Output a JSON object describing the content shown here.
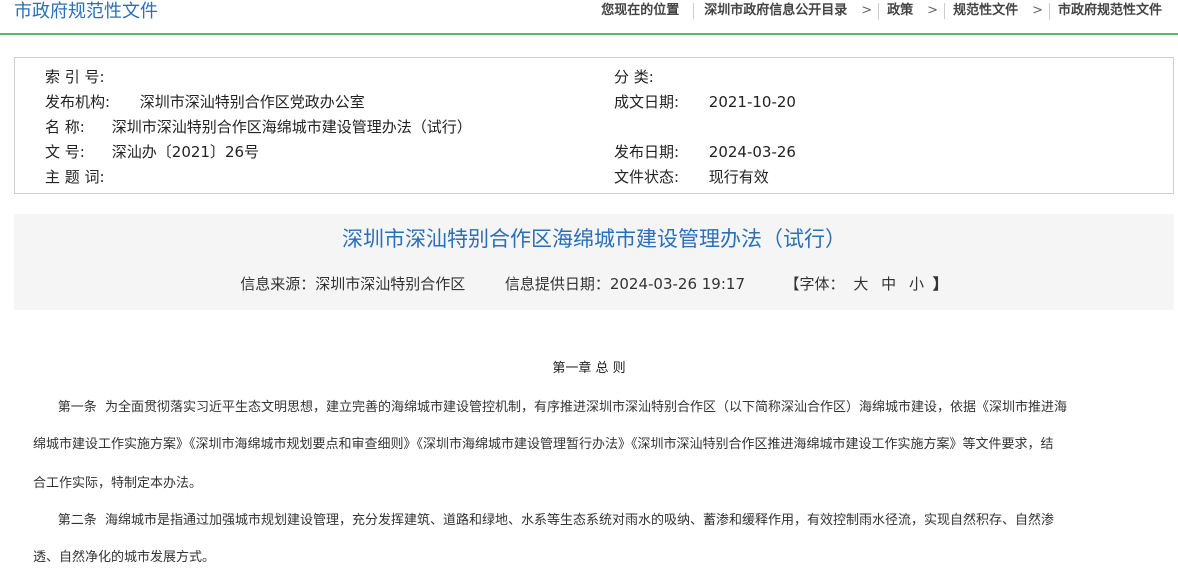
{
  "header": {
    "section_title": "市政府规范性文件",
    "breadcrumb": {
      "location_label": "您现在的位置",
      "items": [
        "深圳市政府信息公开目录",
        "政策",
        "规范性文件",
        "市政府规范性文件"
      ],
      "separator": ">"
    }
  },
  "info": {
    "index_label": "索 引 号:",
    "index_value": "",
    "category_label": "分       类:",
    "category_value": "",
    "publisher_label": "发布机构:",
    "publisher_value": "深圳市深汕特别合作区党政办公室",
    "written_date_label": "成文日期:",
    "written_date_value": "2021-10-20",
    "name_label": "名       称:",
    "name_value": "深圳市深汕特别合作区海绵城市建设管理办法（试行）",
    "doc_no_label": "文       号:",
    "doc_no_value": "深汕办〔2021〕26号",
    "publish_date_label": "发布日期:",
    "publish_date_value": "2024-03-26",
    "subject_label": "主 题 词:",
    "subject_value": "",
    "status_label": "文件状态:",
    "status_value": "现行有效"
  },
  "document": {
    "title": "深圳市深汕特别合作区海绵城市建设管理办法（试行）",
    "source": "信息来源：深圳市深汕特别合作区",
    "provided_date": "信息提供日期：2024-03-26 19:17",
    "font_size_label": "【字体：",
    "font_sizes": [
      "大",
      "中",
      "小"
    ],
    "font_size_close": "】"
  },
  "body": {
    "chapter_heading": "第一章 总 则",
    "lines": [
      "      第一条  为全面贯彻落实习近平生态文明思想，建立完善的海绵城市建设管控机制，有序推进深圳市深汕特别合作区（以下简称深汕合作区）海绵城市建设，依据《深圳市推进海",
      "绵城市建设工作实施方案》《深圳市海绵城市规划要点和审查细则》《深圳市海绵城市建设管理暂行办法》《深圳市深汕特别合作区推进海绵城市建设工作实施方案》等文件要求，结",
      "合工作实际，特制定本办法。",
      "      第二条  海绵城市是指通过加强城市规划建设管理，充分发挥建筑、道路和绿地、水系等生态系统对雨水的吸纳、蓄渗和缓释作用，有效控制雨水径流，实现自然积存、自然渗",
      "透、自然净化的城市发展方式。"
    ]
  },
  "colors": {
    "accent_blue": "#2a6fb8",
    "divider_green": "#5cb85c",
    "header_bg": "#f5f5f5"
  }
}
